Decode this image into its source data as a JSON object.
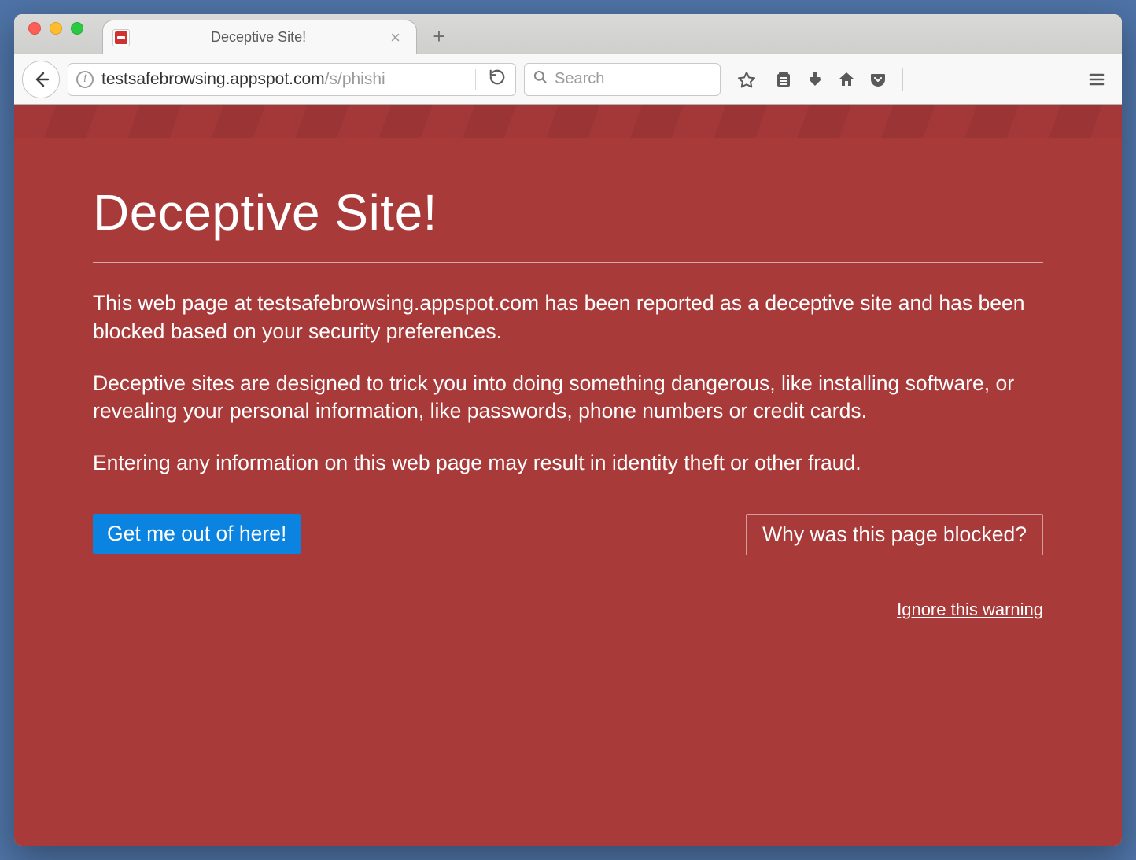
{
  "tab": {
    "title": "Deceptive Site!",
    "favicon_name": "warning-favicon"
  },
  "toolbar": {
    "url_host": "testsafebrowsing.appspot.com",
    "url_path": "/s/phishi",
    "search_placeholder": "Search"
  },
  "warning": {
    "heading": "Deceptive Site!",
    "para1": "This web page at testsafebrowsing.appspot.com has been reported as a deceptive site and has been blocked based on your security preferences.",
    "para2": "Deceptive sites are designed to trick you into doing something dangerous, like installing software, or revealing your personal information, like passwords, phone numbers or credit cards.",
    "para3": "Entering any information on this web page may result in identity theft or other fraud.",
    "primary_button": "Get me out of here!",
    "secondary_button": "Why was this page blocked?",
    "ignore_link": "Ignore this warning"
  }
}
